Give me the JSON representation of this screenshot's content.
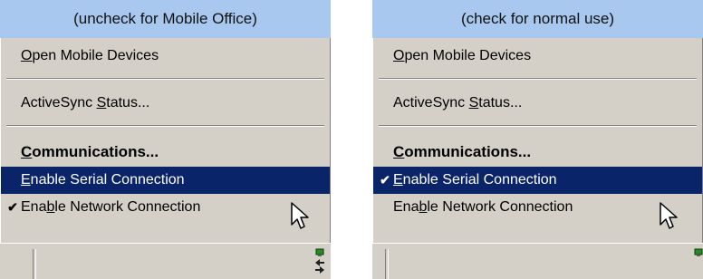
{
  "panels": [
    {
      "header": "(uncheck for Mobile Office)",
      "menu": {
        "open_devices": {
          "prefix": "",
          "key": "O",
          "rest": "pen Mobile Devices"
        },
        "status": {
          "prefix": "ActiveSync ",
          "key": "S",
          "rest": "tatus..."
        },
        "communications": {
          "prefix": "",
          "key": "C",
          "rest": "ommunications..."
        },
        "serial": {
          "prefix": "",
          "key": "E",
          "rest": "nable Serial Connection",
          "checked": false,
          "highlighted": true
        },
        "network": {
          "prefix": "Ena",
          "key": "b",
          "rest": "le Network Connection",
          "checked": true,
          "highlighted": false
        }
      }
    },
    {
      "header": "(check for normal use)",
      "menu": {
        "open_devices": {
          "prefix": "",
          "key": "O",
          "rest": "pen Mobile Devices"
        },
        "status": {
          "prefix": "ActiveSync ",
          "key": "S",
          "rest": "tatus..."
        },
        "communications": {
          "prefix": "",
          "key": "C",
          "rest": "ommunications..."
        },
        "serial": {
          "prefix": "",
          "key": "E",
          "rest": "nable Serial Connection",
          "checked": true,
          "highlighted": true
        },
        "network": {
          "prefix": "Ena",
          "key": "b",
          "rest": "le Network Connection",
          "checked": false,
          "highlighted": false
        }
      }
    }
  ],
  "colors": {
    "header_bg": "#a8c8f0",
    "menu_bg": "#d4d0c8",
    "highlight_bg": "#0a246a",
    "highlight_text": "#ffffff"
  },
  "icons": {
    "check": "checkmark-icon",
    "cursor": "arrow-cursor-icon",
    "tray": "activesync-tray-icon"
  },
  "check_glyph": "✔"
}
